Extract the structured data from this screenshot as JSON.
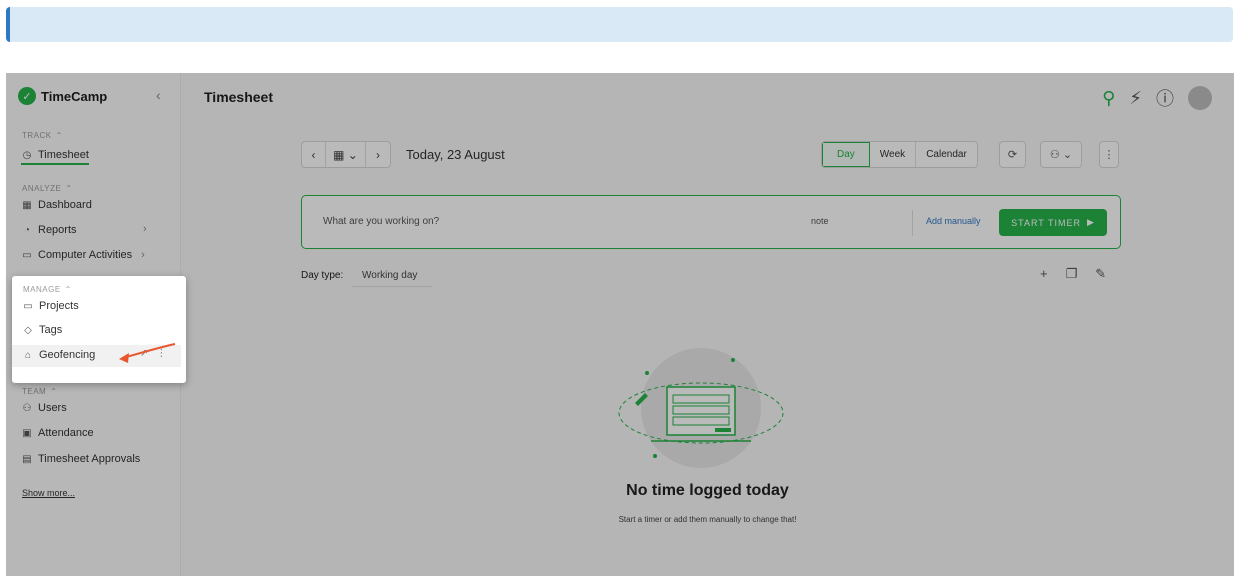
{
  "app": {
    "name": "TimeCamp",
    "collapse_icon": "chevron-left"
  },
  "sidebar": {
    "track": {
      "label": "TRACK",
      "items": [
        {
          "label": "Timesheet",
          "icon": "clock-icon",
          "active": true
        }
      ]
    },
    "analyze": {
      "label": "ANALYZE",
      "items": [
        {
          "label": "Dashboard",
          "icon": "grid-icon"
        },
        {
          "label": "Reports",
          "icon": "reports-icon"
        },
        {
          "label": "Computer Activities",
          "icon": "laptop-icon"
        }
      ]
    },
    "manage": {
      "label": "MANAGE",
      "items": [
        {
          "label": "Projects",
          "icon": "folder-icon"
        },
        {
          "label": "Tags",
          "icon": "tag-icon"
        },
        {
          "label": "Geofencing",
          "icon": "map-icon"
        }
      ]
    },
    "team": {
      "label": "TEAM",
      "items": [
        {
          "label": "Users",
          "icon": "users-icon"
        },
        {
          "label": "Attendance",
          "icon": "attendance-icon"
        },
        {
          "label": "Timesheet Approvals",
          "icon": "approvals-icon"
        }
      ]
    },
    "show_more": "Show more..."
  },
  "header": {
    "title": "Timesheet"
  },
  "toolbar": {
    "date_label": "Today, 23 August",
    "views": [
      "Day",
      "Week",
      "Calendar"
    ],
    "active_view": "Day"
  },
  "timer": {
    "placeholder": "What are you working on?",
    "note": "note",
    "add_manually": "Add manually",
    "start_label": "START TIMER"
  },
  "day_type": {
    "label": "Day type:",
    "value": "Working day"
  },
  "empty_state": {
    "title": "No time logged today",
    "subtitle": "Start a timer or add them manually to change that!"
  },
  "colors": {
    "accent": "#25b34b",
    "link": "#2f78c4",
    "arrow": "#e8572e"
  }
}
